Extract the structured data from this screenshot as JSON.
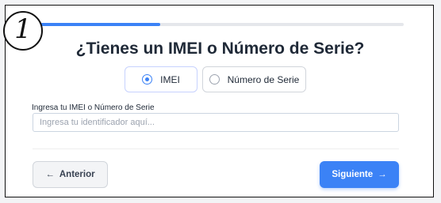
{
  "step_badge": "1",
  "progress": 0.33,
  "title": "¿Tienes un IMEI o Número de Serie?",
  "options": [
    {
      "label": "IMEI",
      "selected": true
    },
    {
      "label": "Número de Serie",
      "selected": false
    }
  ],
  "field": {
    "label": "Ingresa tu IMEI o Número de Serie",
    "placeholder": "Ingresa tu identificador aquí...",
    "value": ""
  },
  "buttons": {
    "prev_icon": "←",
    "prev_label": "Anterior",
    "next_label": "Siguiente",
    "next_icon": "→"
  },
  "colors": {
    "accent": "#3b82f6",
    "title": "#1f2937"
  }
}
